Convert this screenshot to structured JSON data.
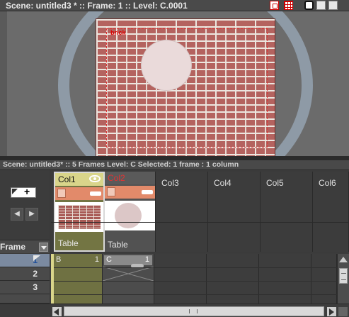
{
  "viewer": {
    "title": "Scene: untitled3 *  ::  Frame: 1  ::  Level: C.0001",
    "image_label": "brick"
  },
  "xsheet": {
    "info": "Scene: untitled3*  ::   5 Frames  Level: C   Selected: 1 frame : 1 column",
    "frame_label": "Frame",
    "nav_prev": "◀",
    "nav_next": "▶",
    "columns": [
      {
        "name": "Col1",
        "footer": "Table"
      },
      {
        "name": "Col2",
        "footer": "Table"
      },
      {
        "name": "Col3"
      },
      {
        "name": "Col4"
      },
      {
        "name": "Col5"
      },
      {
        "name": "Col6"
      }
    ],
    "rows": [
      "1",
      "2",
      "3"
    ],
    "cells": {
      "col1_level": "B",
      "col1_frame": "1",
      "col2_level": "C",
      "col2_frame": "1"
    }
  },
  "colors": {
    "accent": "#d9d58a",
    "level_col": "#e28a6a",
    "current_row": "#7b8aa0"
  }
}
